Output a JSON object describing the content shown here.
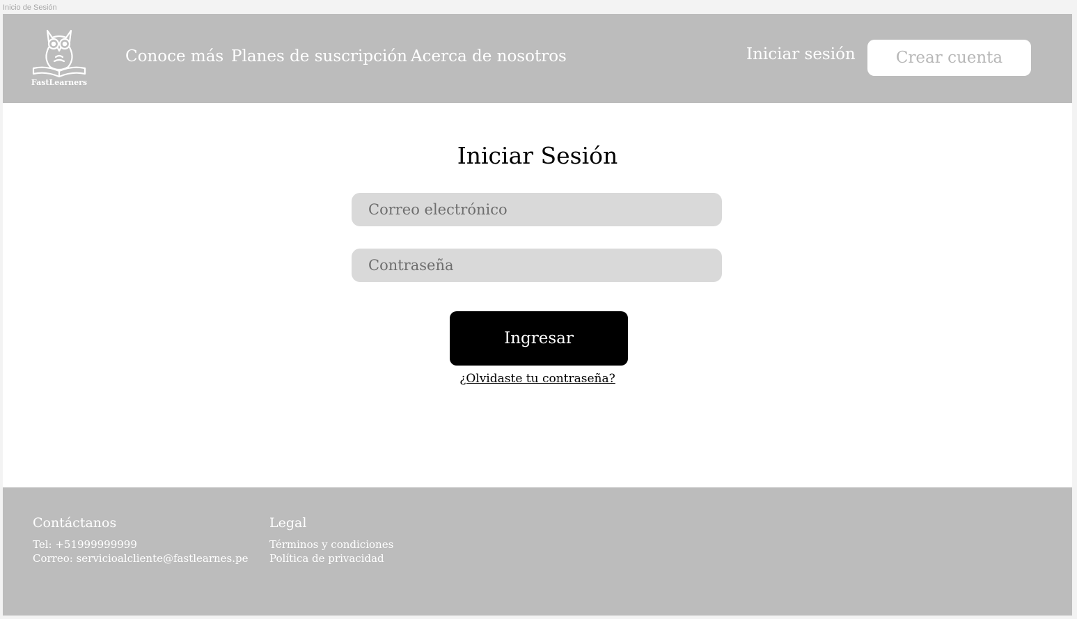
{
  "frame": {
    "label": "Inicio de Sesión"
  },
  "header": {
    "logo_text": "FastLearners",
    "nav": [
      {
        "label": "Conoce más"
      },
      {
        "label": "Planes de suscripción"
      },
      {
        "label": "Acerca de nosotros"
      }
    ],
    "login_label": "Iniciar sesión",
    "signup_label": "Crear cuenta"
  },
  "login": {
    "title": "Iniciar Sesión",
    "email_placeholder": "Correo electrónico",
    "password_placeholder": "Contraseña",
    "submit_label": "Ingresar",
    "forgot_label": "¿Olvidaste tu contraseña?"
  },
  "footer": {
    "contact": {
      "heading": "Contáctanos",
      "phone": "Tel: +51999999999",
      "email": "Correo: servicioalcliente@fastlearnes.pe"
    },
    "legal": {
      "heading": "Legal",
      "terms": "Términos y condiciones",
      "privacy": "Política de privacidad"
    }
  },
  "colors": {
    "header_bg": "#bcbcbc",
    "footer_bg": "#bcbcbc",
    "input_bg": "#d9d9d9",
    "primary_button": "#000000"
  }
}
